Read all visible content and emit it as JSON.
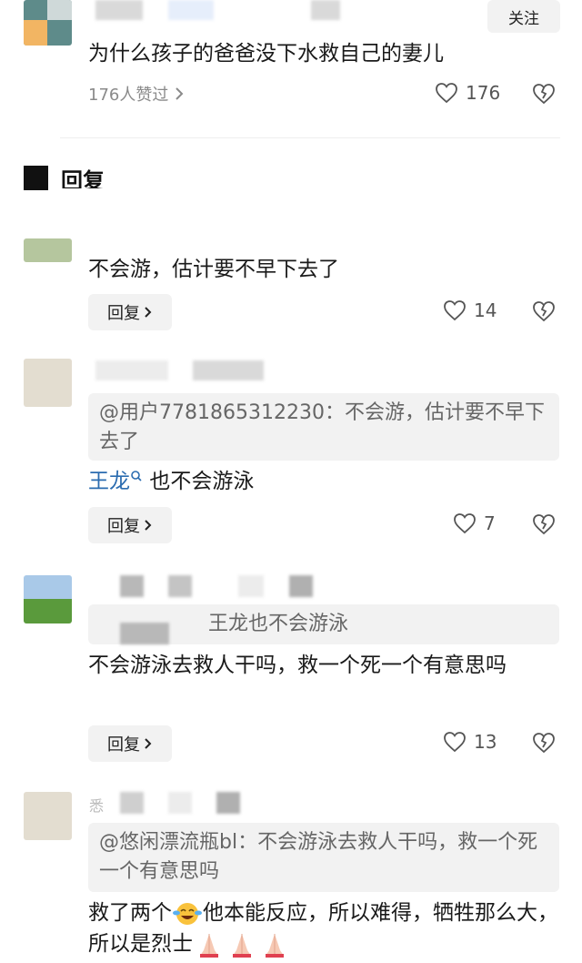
{
  "post": {
    "follow_label": "关注",
    "title": "为什么孩子的爸爸没下水救自己的妻儿",
    "likes_summary": "176人赞过",
    "like_count": "176"
  },
  "section": {
    "label": "回复"
  },
  "comments": [
    {
      "text": "不会游，估计要不早下去了",
      "reply_label": "回复",
      "like_count": "14"
    },
    {
      "quote": "@用户7781865312230：不会游，估计要不早下去了",
      "mention": "王龙",
      "text": "也不会游泳",
      "reply_label": "回复",
      "like_count": "7"
    },
    {
      "quote": "王龙也不会游泳",
      "text": "不会游泳去救人干吗，救一个死一个有意思吗",
      "reply_label": "回复",
      "like_count": "13"
    },
    {
      "name_fragment": "悉",
      "quote": "@悠闲漂流瓶bl：不会游泳去救人干吗，救一个死一个有意思吗",
      "text_before_emoji": "救了两个",
      "text_after_emoji": "他本能反应，所以难得，牺牲那么大，所以是烈士",
      "emoji_names": [
        "laughing-crying-emoji",
        "praying-hands-emoji",
        "praying-hands-emoji",
        "praying-hands-emoji"
      ]
    }
  ],
  "colors": {
    "accent_link": "#2b6cb0",
    "gray_text": "#8a8a8a",
    "button_bg": "#f2f2f2"
  }
}
